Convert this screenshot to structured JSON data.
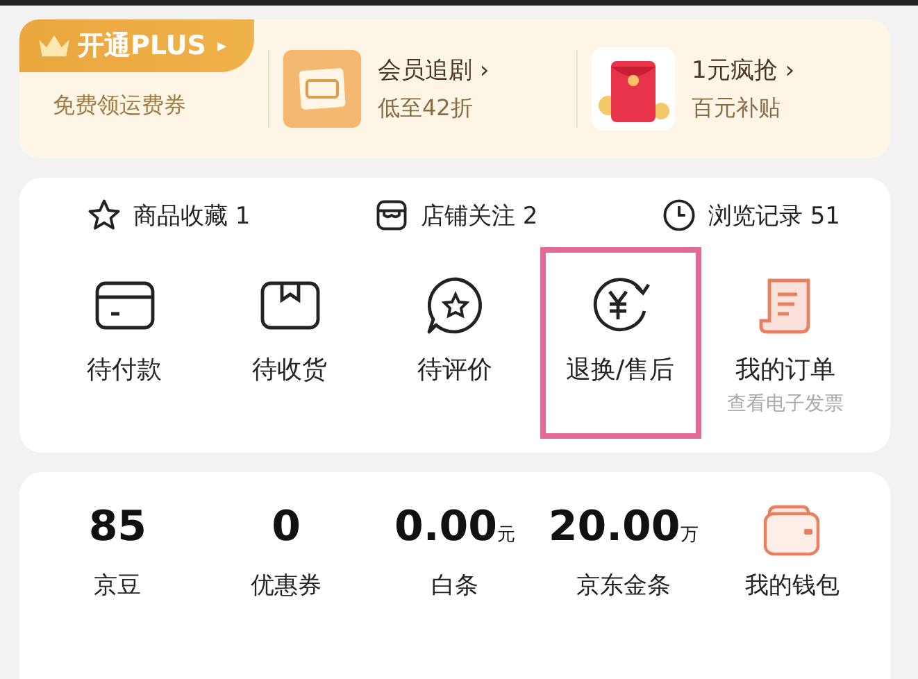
{
  "plus_banner": {
    "plus_button": "开通PLUS",
    "plus_arrow": "▸",
    "plus_subtitle": "免费领运费券",
    "promos": [
      {
        "kind": "video",
        "title": "会员追剧",
        "arrow": "›",
        "subtitle": "低至42折"
      },
      {
        "kind": "envelope",
        "title": "1元疯抢",
        "arrow": "›",
        "subtitle": "百元补贴"
      }
    ]
  },
  "shortcuts": [
    {
      "kind": "star",
      "label": "商品收藏",
      "count": "1"
    },
    {
      "kind": "shop",
      "label": "店铺关注",
      "count": "2"
    },
    {
      "kind": "clock",
      "label": "浏览记录",
      "count": "51"
    }
  ],
  "orders": [
    {
      "kind": "card",
      "label": "待付款",
      "highlighted": false
    },
    {
      "kind": "box",
      "label": "待收货",
      "highlighted": false
    },
    {
      "kind": "review",
      "label": "待评价",
      "highlighted": false
    },
    {
      "kind": "refund",
      "label": "退换/售后",
      "highlighted": true
    },
    {
      "kind": "receipt",
      "label": "我的订单",
      "sublabel": "查看电子发票",
      "highlighted": false
    }
  ],
  "assets": [
    {
      "kind": "value",
      "value": "85",
      "label": "京豆"
    },
    {
      "kind": "value",
      "value": "0",
      "label": "优惠券"
    },
    {
      "kind": "value",
      "value": "0.00",
      "unit": "元",
      "label": "白条"
    },
    {
      "kind": "value",
      "value": "20.00",
      "unit": "万",
      "label": "京东金条"
    },
    {
      "kind": "wallet",
      "label": "我的钱包"
    }
  ]
}
